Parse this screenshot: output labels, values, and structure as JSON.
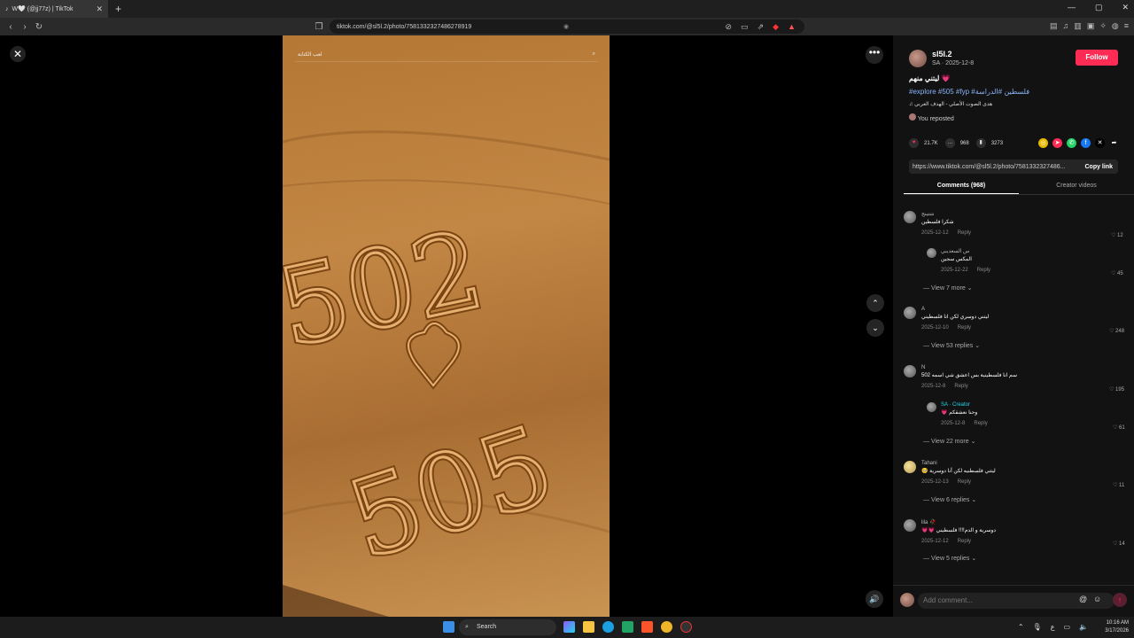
{
  "browser": {
    "tab_title": "W🤍 (@jj77z) | TikTok",
    "url": "tiktok.com/@sl5l.2/photo/7581332327486278919"
  },
  "icons": {
    "close": "close-icon",
    "more": "more-icon",
    "up": "chevron-up-icon",
    "down": "chevron-down-icon",
    "volume": "volume-icon"
  },
  "photo": {
    "search_text": "لعب الكتابة",
    "sand_text_top": "502",
    "sand_text_bottom": "505"
  },
  "panel": {
    "author": "sl5l.2",
    "author_sub": "SA · 2025-12-8",
    "follow_label": "Follow",
    "caption": "ليتني منهم 💗",
    "tags": "#explore #505 #fyp #فلسطين #الدراسة",
    "music": "♫ هدى الصوت الأصلي - الهدف العربي",
    "reposted": "You reposted",
    "likes": "21.7K",
    "comments_count": "968",
    "saves": "3273",
    "link": "https://www.tiktok.com/@sl5l.2/photo/7581332327486...",
    "copy_link": "Copy link",
    "tab_comments": "Comments (968)",
    "tab_creator": "Creator videos",
    "add_comment_placeholder": "Add comment...",
    "comments": [
      {
        "name": "نتنتينج",
        "text": "شكرا فلسطين",
        "date": "2025-12-12",
        "reply": "Reply",
        "likes": "12"
      },
      {
        "name": "س السعديبي",
        "text": "المكس سجين",
        "date": "2025-12-22",
        "reply": "Reply",
        "likes": "45",
        "viewmore": "View 7 more"
      },
      {
        "name": "A",
        "text": "ليتني دوسري لكن انا فلسطيني",
        "date": "2025-12-10",
        "reply": "Reply",
        "likes": "248",
        "viewmore": "View 53 replies"
      },
      {
        "name": "N",
        "text": "502 سم انا فلسطينية بس اعشق شي اسمه",
        "date": "2025-12-8",
        "reply": "Reply",
        "likes": "195"
      },
      {
        "name": "SA · Creator",
        "text": "💗 وحنا نعشقكم",
        "date": "2025-12-8",
        "reply": "Reply",
        "likes": "61",
        "viewmore": "View 22 more"
      },
      {
        "name": "Tahani",
        "text": "🥺 ليتني فلسطنيه لكن أنا دوسرية",
        "date": "2025-12-13",
        "reply": "Reply",
        "likes": "11",
        "viewmore": "View 6 replies"
      },
      {
        "name": "lila 🥀",
        "text": "💗💗 دوسرية و الدم!!!! فلسطيني",
        "date": "2025-12-12",
        "reply": "Reply",
        "likes": "14",
        "viewmore": "View 5 replies"
      }
    ]
  },
  "taskbar": {
    "search_label": "Search",
    "time": "10:16 AM",
    "date": "3/17/2026"
  }
}
